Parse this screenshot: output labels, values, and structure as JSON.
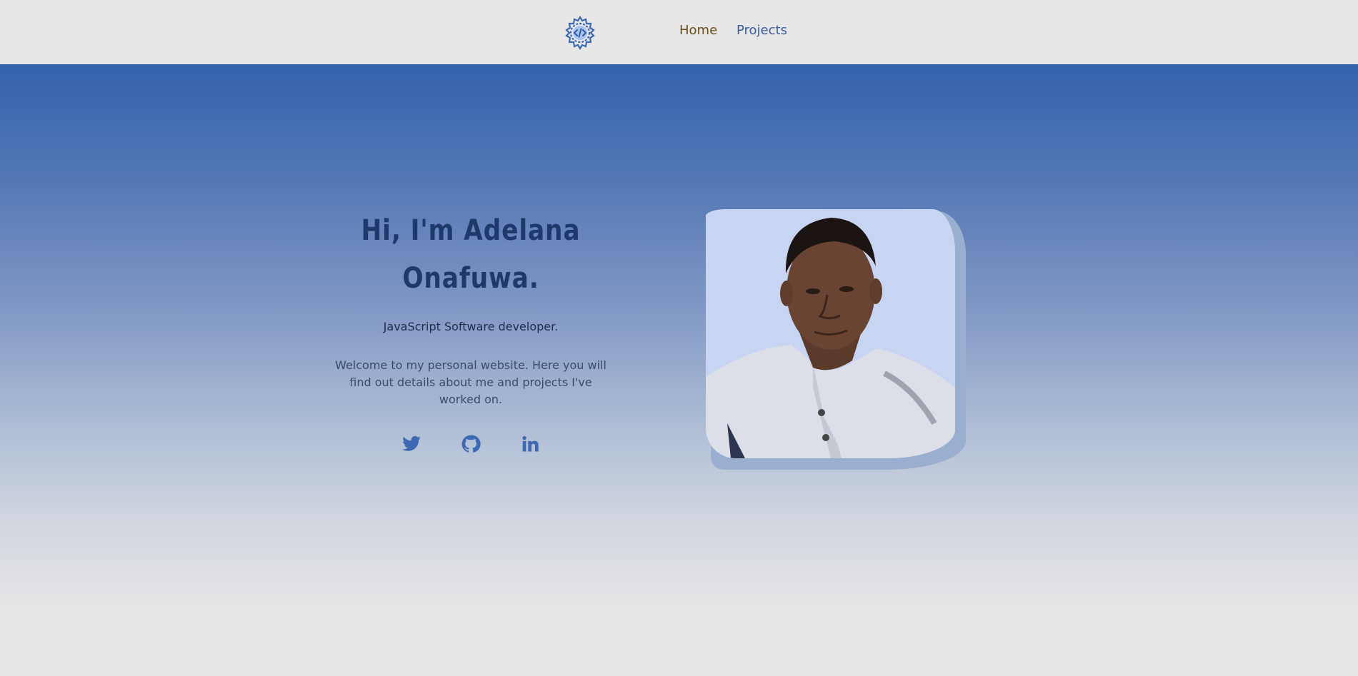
{
  "nav": {
    "logo_icon": "code-gear-icon",
    "links": [
      {
        "label": "Home"
      },
      {
        "label": "Projects"
      }
    ]
  },
  "hero": {
    "title": "Hi, I'm Adelana Onafuwa.",
    "subtitle": "JavaScript Software developer.",
    "description": "Welcome to my personal website. Here you will find out details about me and projects I've worked on.",
    "social_icons": [
      "twitter-icon",
      "github-icon",
      "linkedin-icon"
    ],
    "photo": "profile-photo"
  },
  "colors": {
    "accent": "#3d68b4",
    "heading": "#1d3a6b",
    "nav_active": "#6b4c1b",
    "nav_link": "#3a5c9e",
    "gradient_top": "#3462ad",
    "background": "#e7e7e7"
  }
}
